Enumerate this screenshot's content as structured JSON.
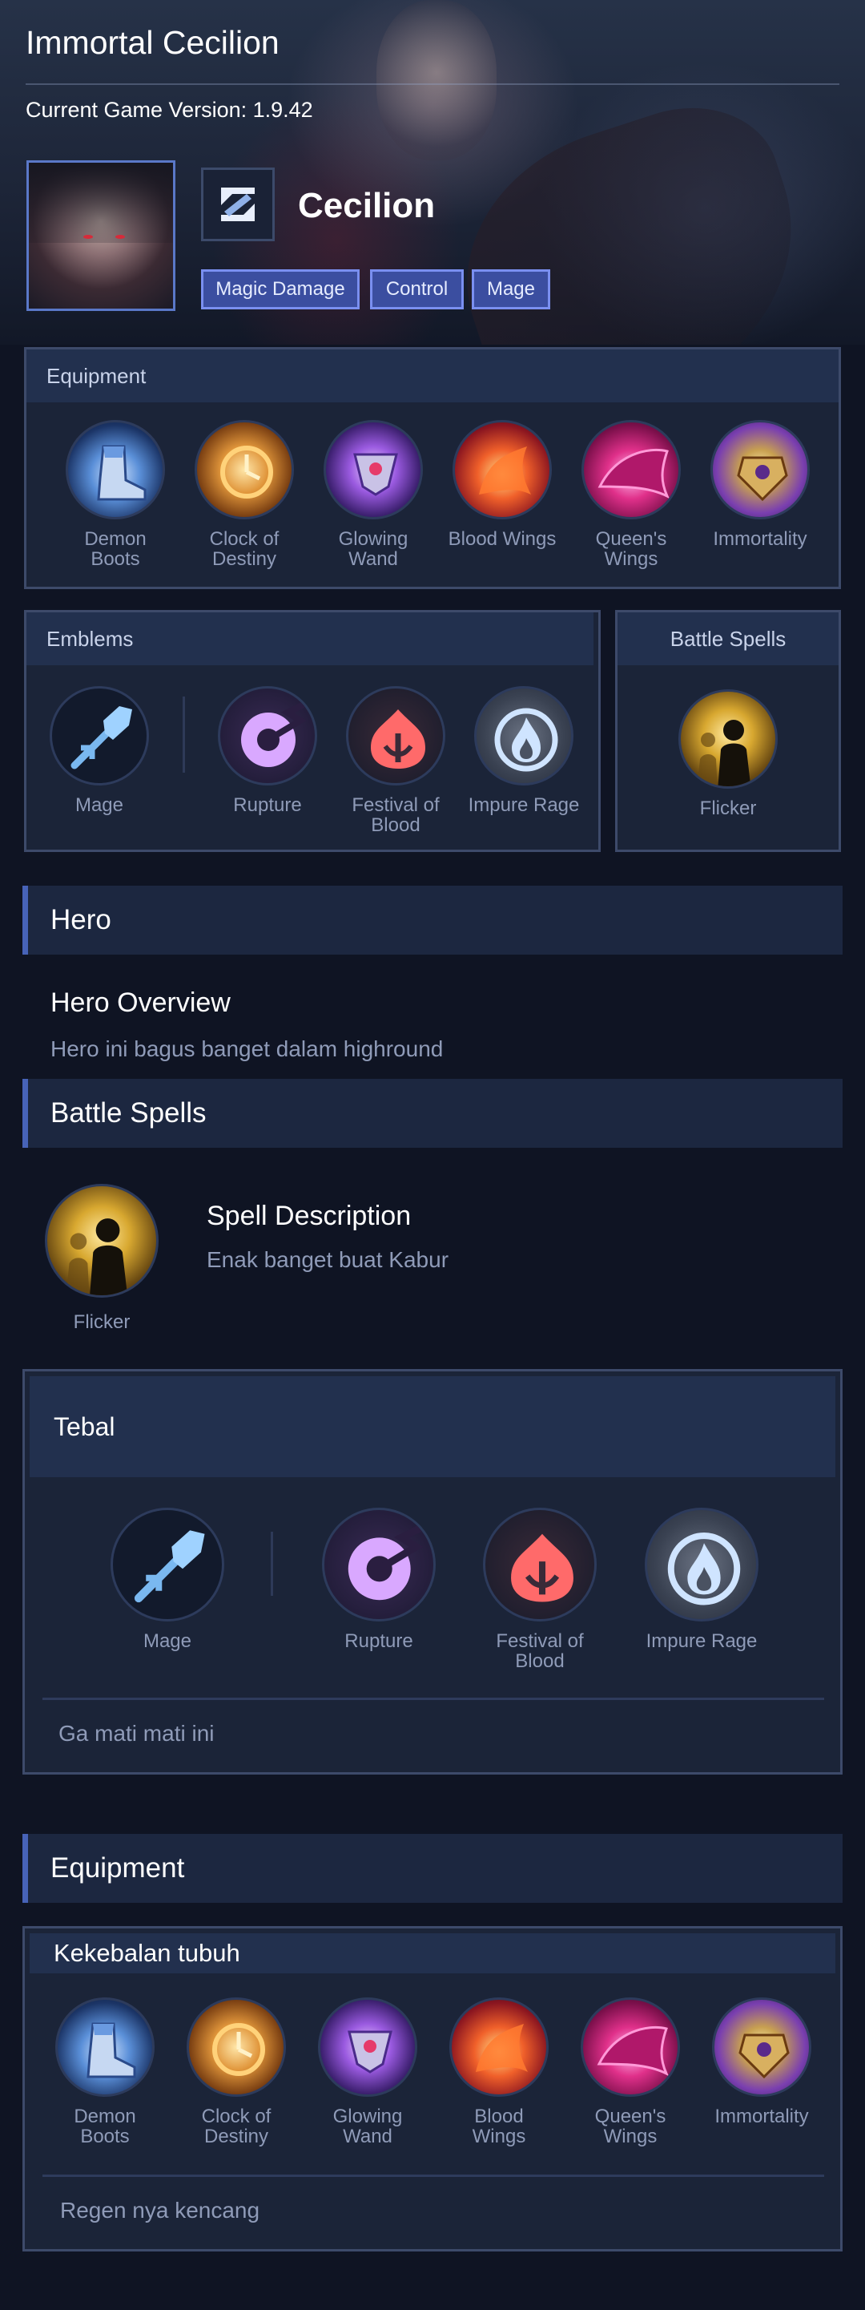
{
  "header": {
    "title": "Immortal Cecilion",
    "version": "Current Game Version: 1.9.42"
  },
  "hero": {
    "name": "Cecilion",
    "tags": [
      "Magic Damage",
      "Control",
      "Mage"
    ]
  },
  "equipment_panel": {
    "title": "Equipment",
    "items": [
      {
        "name": "Demon\nBoots",
        "icon": "boots-icon"
      },
      {
        "name": "Clock of\nDestiny",
        "icon": "clock-icon"
      },
      {
        "name": "Glowing\nWand",
        "icon": "wand-icon"
      },
      {
        "name": "Blood Wings",
        "icon": "blood-wings-icon"
      },
      {
        "name": "Queen's\nWings",
        "icon": "queens-wings-icon"
      },
      {
        "name": "Immortality",
        "icon": "immortality-icon"
      }
    ]
  },
  "emblems_panel": {
    "title": "Emblems",
    "emblem": "Mage",
    "talents": [
      "Rupture",
      "Festival of\nBlood",
      "Impure Rage"
    ]
  },
  "spells_panel": {
    "title": "Battle Spells",
    "spell": "Flicker"
  },
  "hero_section": {
    "title": "Hero",
    "overview_title": "Hero Overview",
    "overview_text": "Hero ini bagus banget dalam highround"
  },
  "battle_spells_section": {
    "title": "Battle Spells",
    "spell": "Flicker",
    "description_title": "Spell Description",
    "description_text": "Enak banget buat Kabur"
  },
  "emblem_build": {
    "title": "Tebal",
    "emblem": "Mage",
    "talents": [
      "Rupture",
      "Festival of\nBlood",
      "Impure Rage"
    ],
    "note": "Ga mati mati ini"
  },
  "equipment_section": {
    "title": "Equipment"
  },
  "equipment_build": {
    "title": "Kekebalan tubuh",
    "items": [
      "Demon\nBoots",
      "Clock of\nDestiny",
      "Glowing\nWand",
      "Blood\nWings",
      "Queen's\nWings",
      "Immortality"
    ],
    "note": "Regen nya kencang"
  },
  "colors": {
    "background": "#0f1423",
    "panel": "#1b2438",
    "panel_header": "#22304e",
    "accent": "#4763b8",
    "tag_bg": "#3b4ea0",
    "muted_text": "#8f9bb8"
  }
}
